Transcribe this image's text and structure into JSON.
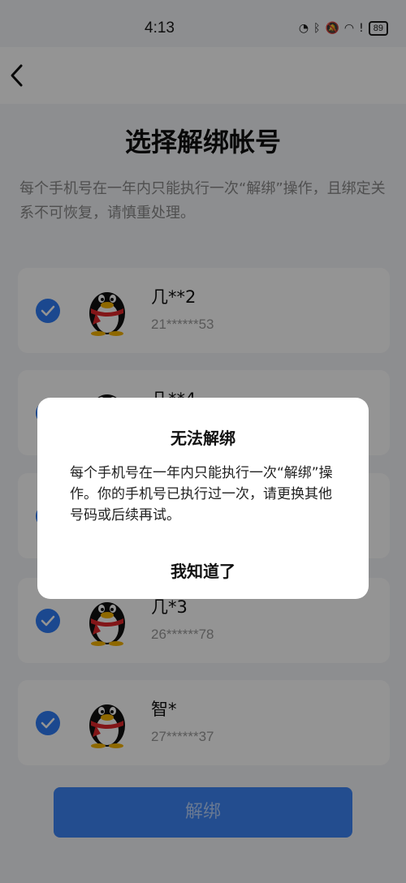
{
  "status_bar": {
    "time": "4:13",
    "battery": "89"
  },
  "page": {
    "title": "选择解绑帐号",
    "description": "每个手机号在一年内只能执行一次“解绑”操作，且绑定关系不可恢复，请慎重处理。"
  },
  "accounts": [
    {
      "name": "几**2",
      "number": "21******53",
      "checked": true
    },
    {
      "name": "几**4",
      "number": "",
      "checked": true
    },
    {
      "name": "",
      "number": "",
      "checked": true
    },
    {
      "name": "几*3",
      "number": "26******78",
      "checked": true
    },
    {
      "name": "智*",
      "number": "27******37",
      "checked": true
    }
  ],
  "unbind_button": {
    "label": "解绑"
  },
  "dialog": {
    "title": "无法解绑",
    "message": "每个手机号在一年内只能执行一次“解绑”操作。你的手机号已执行过一次，请更换其他号码或后续再试。",
    "confirm_label": "我知道了"
  },
  "colors": {
    "accent": "#2f7df6",
    "button": "#3d86f7"
  }
}
